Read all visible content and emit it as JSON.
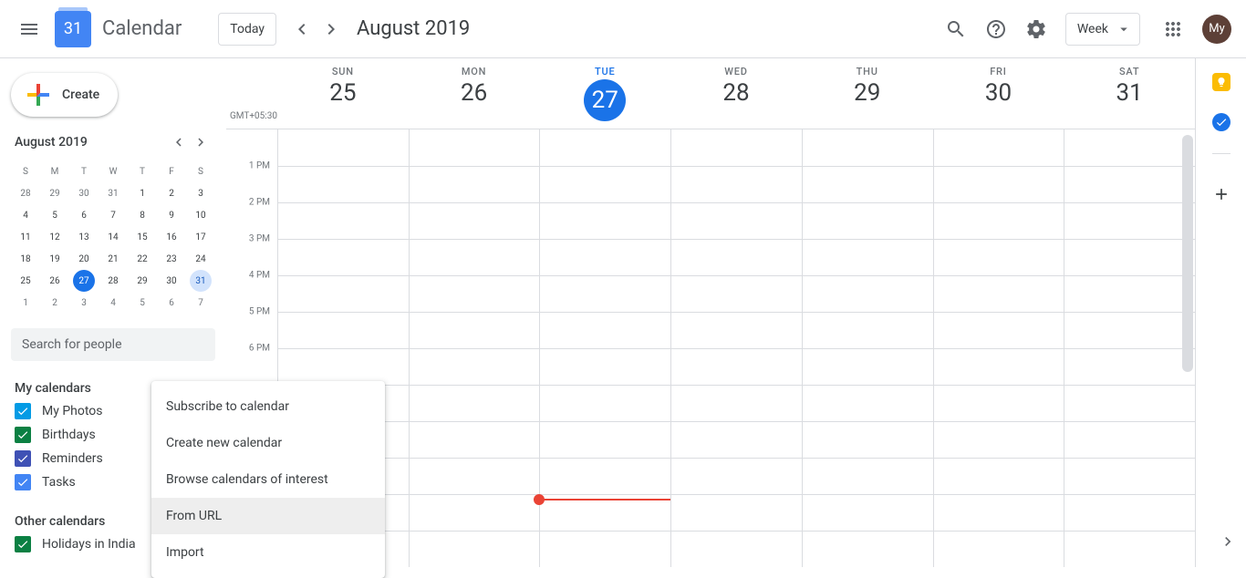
{
  "header": {
    "app_title": "Calendar",
    "logo_day": "31",
    "today_label": "Today",
    "date_title": "August 2019",
    "view_label": "Week",
    "avatar_initials": "My"
  },
  "sidebar": {
    "create_label": "Create",
    "mini_title": "August 2019",
    "day_abbrevs": [
      "S",
      "M",
      "T",
      "W",
      "T",
      "F",
      "S"
    ],
    "mini_weeks": [
      [
        {
          "d": "28",
          "other": true
        },
        {
          "d": "29",
          "other": true
        },
        {
          "d": "30",
          "other": true
        },
        {
          "d": "31",
          "other": true
        },
        {
          "d": "1"
        },
        {
          "d": "2"
        },
        {
          "d": "3"
        }
      ],
      [
        {
          "d": "4"
        },
        {
          "d": "5"
        },
        {
          "d": "6"
        },
        {
          "d": "7"
        },
        {
          "d": "8"
        },
        {
          "d": "9"
        },
        {
          "d": "10"
        }
      ],
      [
        {
          "d": "11"
        },
        {
          "d": "12"
        },
        {
          "d": "13"
        },
        {
          "d": "14"
        },
        {
          "d": "15"
        },
        {
          "d": "16"
        },
        {
          "d": "17"
        }
      ],
      [
        {
          "d": "18"
        },
        {
          "d": "19"
        },
        {
          "d": "20"
        },
        {
          "d": "21"
        },
        {
          "d": "22"
        },
        {
          "d": "23"
        },
        {
          "d": "24"
        }
      ],
      [
        {
          "d": "25"
        },
        {
          "d": "26"
        },
        {
          "d": "27",
          "selected": true
        },
        {
          "d": "28"
        },
        {
          "d": "29"
        },
        {
          "d": "30"
        },
        {
          "d": "31",
          "highlighted": true
        }
      ],
      [
        {
          "d": "1",
          "other": true
        },
        {
          "d": "2",
          "other": true
        },
        {
          "d": "3",
          "other": true
        },
        {
          "d": "4",
          "other": true
        },
        {
          "d": "5",
          "other": true
        },
        {
          "d": "6",
          "other": true
        },
        {
          "d": "7",
          "other": true
        }
      ]
    ],
    "search_placeholder": "Search for people",
    "my_calendars_title": "My calendars",
    "my_calendars": [
      {
        "label": "My Photos",
        "color": "#039be5"
      },
      {
        "label": "Birthdays",
        "color": "#0b8043"
      },
      {
        "label": "Reminders",
        "color": "#3f51b5"
      },
      {
        "label": "Tasks",
        "color": "#4285f4"
      }
    ],
    "other_calendars_title": "Other calendars",
    "other_calendars": [
      {
        "label": "Holidays in India",
        "color": "#0b8043"
      }
    ]
  },
  "context_menu": {
    "items": [
      {
        "label": "Subscribe to calendar"
      },
      {
        "label": "Create new calendar"
      },
      {
        "label": "Browse calendars of interest"
      },
      {
        "label": "From URL",
        "hovered": true
      },
      {
        "label": "Import"
      }
    ]
  },
  "grid": {
    "tz": "GMT+05:30",
    "days": [
      {
        "abbrev": "SUN",
        "num": "25"
      },
      {
        "abbrev": "MON",
        "num": "26"
      },
      {
        "abbrev": "TUE",
        "num": "27",
        "today": true
      },
      {
        "abbrev": "WED",
        "num": "28"
      },
      {
        "abbrev": "THU",
        "num": "29"
      },
      {
        "abbrev": "FRI",
        "num": "30"
      },
      {
        "abbrev": "SAT",
        "num": "31"
      }
    ],
    "time_labels": [
      "1 PM",
      "2 PM",
      "3 PM",
      "4 PM",
      "5 PM",
      "6 PM"
    ]
  }
}
